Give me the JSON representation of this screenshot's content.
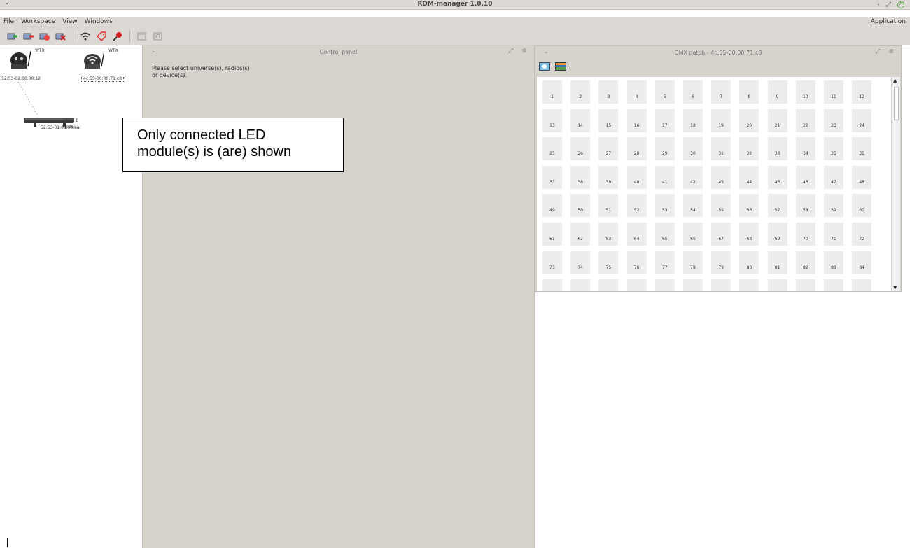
{
  "window": {
    "title": "RDM-manager 1.0.10",
    "controls": {
      "minimize": "-",
      "restore": "⤢",
      "close": "×"
    },
    "menu_glyph": "⌄"
  },
  "menubar": {
    "items": [
      "File",
      "Workspace",
      "View",
      "Windows"
    ],
    "right_item": "Application"
  },
  "toolbar": {
    "icons": [
      "add-universe-icon",
      "remove-universe-icon",
      "disconnect-icon",
      "delete-icon",
      "wifi-icon",
      "tag-icon",
      "search-icon",
      "window-icon",
      "settings-icon"
    ]
  },
  "tree": {
    "radios": [
      {
        "tag": "WTX",
        "address": "52:53-02:00:00:12",
        "selected": false
      },
      {
        "tag": "WTX",
        "address": "4c:55-00:00:71:c8",
        "selected": true
      }
    ],
    "device": {
      "address": "52:53-01:0a:00:aa",
      "dmx": "DMX: 1",
      "mode": "Mode: 1"
    }
  },
  "control_panel": {
    "title": "Control panel",
    "message_lines": [
      "Please select universe(s), radios(s)",
      "or device(s)."
    ]
  },
  "dmx_patch": {
    "title": "DMX patch - 4c:55-00:00:71:c8",
    "tools": [
      "identify-icon",
      "image-icon"
    ],
    "channels": [
      "1",
      "2",
      "3",
      "4",
      "5",
      "6",
      "7",
      "8",
      "9",
      "10",
      "11",
      "12",
      "13",
      "14",
      "15",
      "16",
      "17",
      "18",
      "19",
      "20",
      "21",
      "22",
      "23",
      "24",
      "25",
      "26",
      "27",
      "28",
      "29",
      "30",
      "31",
      "32",
      "33",
      "34",
      "35",
      "36",
      "37",
      "38",
      "39",
      "40",
      "41",
      "42",
      "43",
      "44",
      "45",
      "46",
      "47",
      "48",
      "49",
      "50",
      "51",
      "52",
      "53",
      "54",
      "55",
      "56",
      "57",
      "58",
      "59",
      "60",
      "61",
      "62",
      "63",
      "64",
      "65",
      "66",
      "67",
      "68",
      "69",
      "70",
      "71",
      "72",
      "73",
      "74",
      "75",
      "76",
      "77",
      "78",
      "79",
      "80",
      "81",
      "82",
      "83",
      "84",
      "",
      "",
      "",
      "",
      "",
      "",
      "",
      "",
      "",
      "",
      "",
      ""
    ]
  },
  "annotation": {
    "lines": [
      "Only connected LED",
      "module(s) is (are) shown"
    ]
  },
  "colors": {
    "chrome": "#dcd8d3",
    "panel": "#d6d2cc",
    "channel_cell": "#ededed",
    "close_green": "#5aa84a"
  }
}
